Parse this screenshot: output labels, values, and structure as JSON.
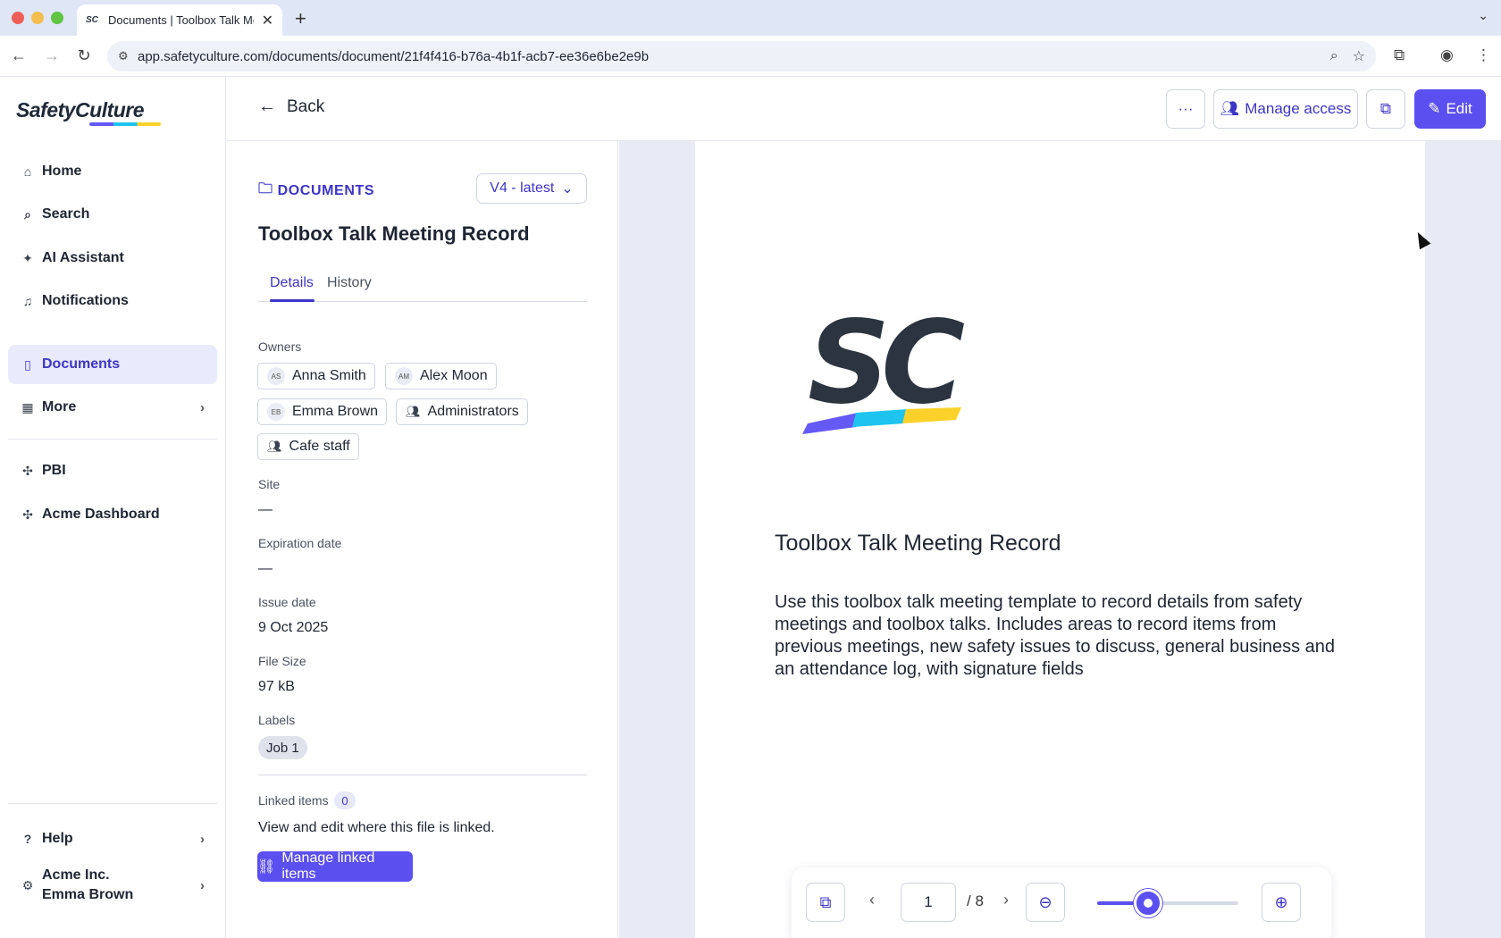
{
  "browser": {
    "tab_title": "Documents | Toolbox Talk Meeting Record",
    "url": "app.safetyculture.com/documents/document/21f4f416-b76a-4b1f-acb7-ee36e6be2e9b"
  },
  "sidebar": {
    "logo": "SafetyCulture",
    "items": [
      {
        "label": "Home",
        "icon": "home-icon"
      },
      {
        "label": "Search",
        "icon": "search-icon"
      },
      {
        "label": "AI Assistant",
        "icon": "sparkle-icon"
      },
      {
        "label": "Notifications",
        "icon": "bell-icon"
      },
      {
        "label": "Documents",
        "icon": "document-icon",
        "active": true
      },
      {
        "label": "More",
        "icon": "grid-icon"
      }
    ],
    "integrations": [
      {
        "label": "PBI",
        "icon": "puzzle-icon"
      },
      {
        "label": "Acme Dashboard",
        "icon": "puzzle-icon"
      }
    ],
    "help": "Help",
    "org_name": "Acme Inc.",
    "user_name": "Emma Brown"
  },
  "header": {
    "back_label": "Back",
    "manage_access": "Manage access",
    "edit": "Edit"
  },
  "details": {
    "folder": "DOCUMENTS",
    "version": "V4 - latest",
    "title": "Toolbox Talk Meeting Record",
    "tabs": [
      "Details",
      "History"
    ],
    "owners_label": "Owners",
    "owners": [
      {
        "initials": "AS",
        "name": "Anna Smith"
      },
      {
        "initials": "AM",
        "name": "Alex Moon"
      },
      {
        "initials": "EB",
        "name": "Emma Brown"
      },
      {
        "name": "Administrators",
        "group": true
      },
      {
        "name": "Cafe staff",
        "group": true
      }
    ],
    "site_label": "Site",
    "site_value": "—",
    "expiration_label": "Expiration date",
    "expiration_value": "—",
    "issue_label": "Issue date",
    "issue_value": "9 Oct 2025",
    "size_label": "File Size",
    "size_value": "97 kB",
    "labels_label": "Labels",
    "labels": [
      "Job 1"
    ],
    "linked_label": "Linked items",
    "linked_count": "0",
    "linked_desc": "View and edit where this file is linked.",
    "manage_linked": "Manage linked items"
  },
  "preview": {
    "title": "Toolbox Talk Meeting Record",
    "description": "Use this toolbox talk meeting template to record details from safety meetings and toolbox talks. Includes areas to record items from previous meetings, new safety issues to discuss, general business and an attendance log, with signature fields",
    "page_current": "1",
    "page_total": "/ 8",
    "zoom_level": 0.36
  },
  "colors": {
    "accent": "#5b4ff0",
    "accent_text": "#3d35c6",
    "brand_purple": "#6559f5",
    "brand_cyan": "#1ec4ef",
    "brand_yellow": "#fcd22a",
    "logo_dark": "#2c3440"
  }
}
